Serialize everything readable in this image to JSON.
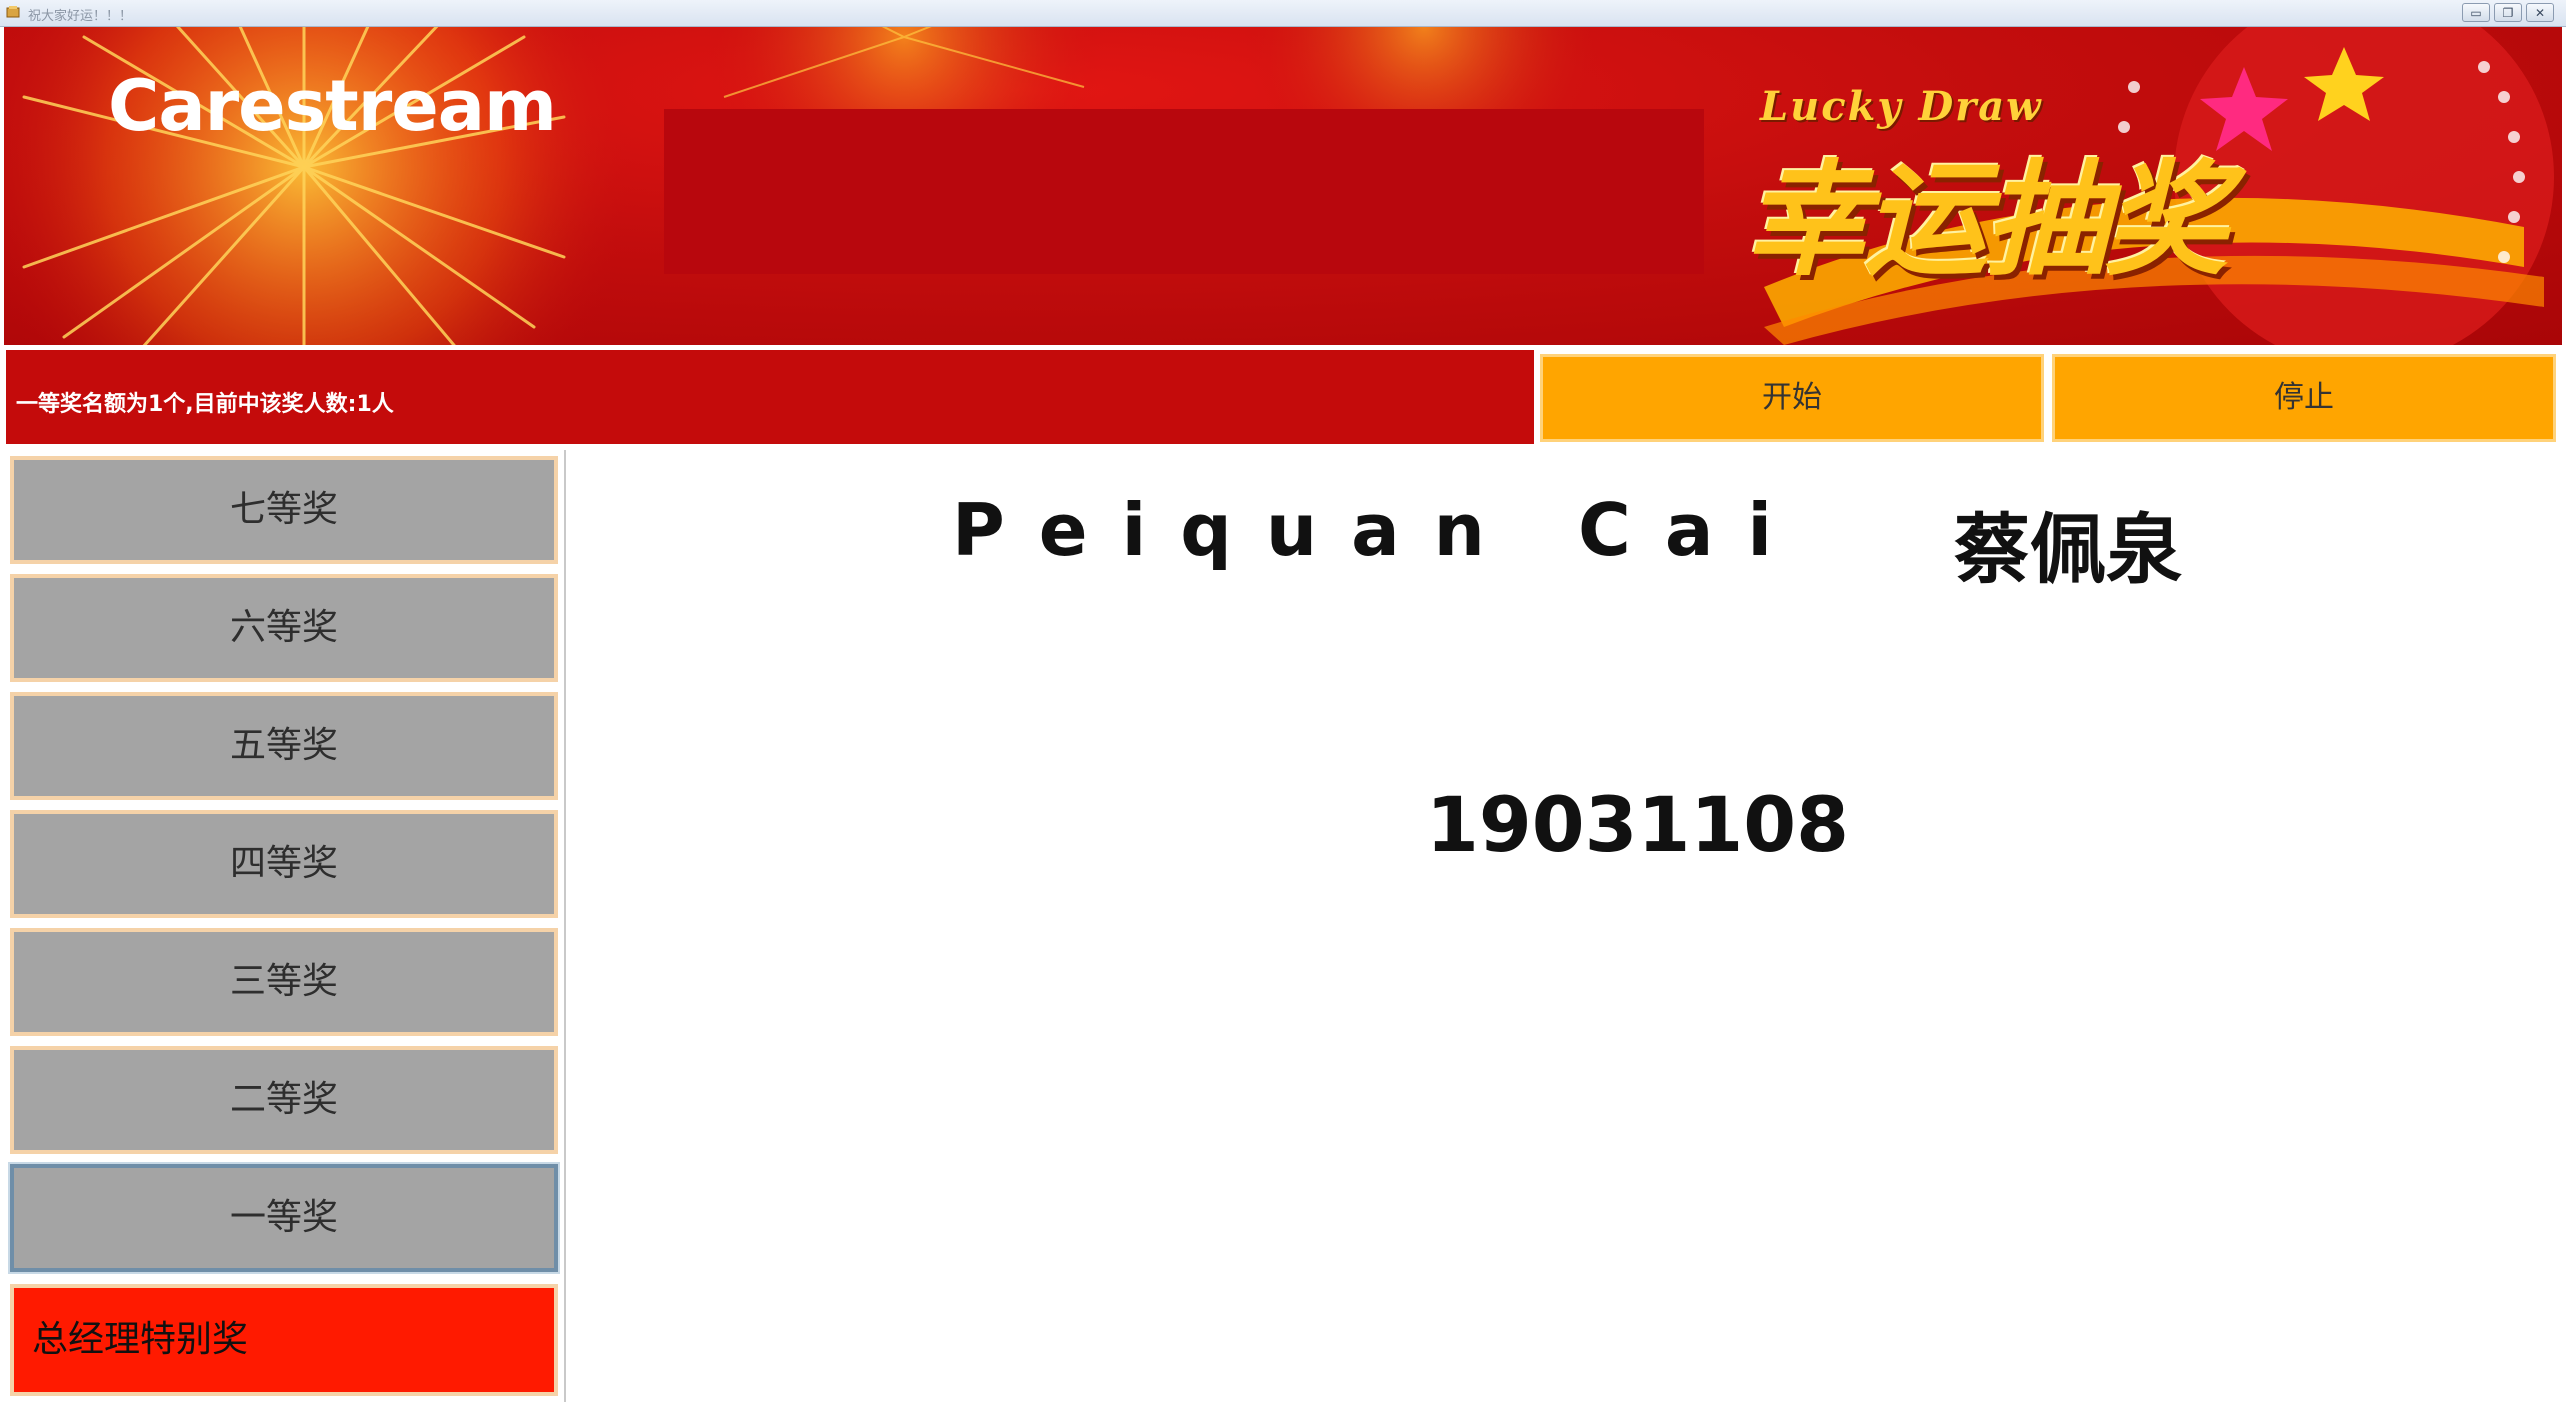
{
  "window": {
    "title": "祝大家好运！！！",
    "minimize_label": "▭",
    "restore_label": "❐",
    "close_label": "✕"
  },
  "banner": {
    "brand": "Carestream",
    "subtitle_en": "Lucky Draw",
    "title_cn": "幸运抽奖"
  },
  "status": {
    "text": "一等奖名额为1个,目前中该奖人数:1人"
  },
  "controls": {
    "start_label": "开始",
    "stop_label": "停止"
  },
  "prizes": [
    {
      "label": "七等奖"
    },
    {
      "label": "六等奖"
    },
    {
      "label": "五等奖"
    },
    {
      "label": "四等奖"
    },
    {
      "label": "三等奖"
    },
    {
      "label": "二等奖"
    },
    {
      "label": "一等奖",
      "selected": true
    },
    {
      "label": "总经理特别奖"
    }
  ],
  "result": {
    "name_en": "Peiquan Cai",
    "name_cn": "蔡佩泉",
    "employee_id": "19031108"
  },
  "colors": {
    "banner_red": "#c30d0d",
    "control_orange": "#ffa500",
    "prize_gray": "#a4a4a4",
    "special_red": "#ff1a00"
  }
}
